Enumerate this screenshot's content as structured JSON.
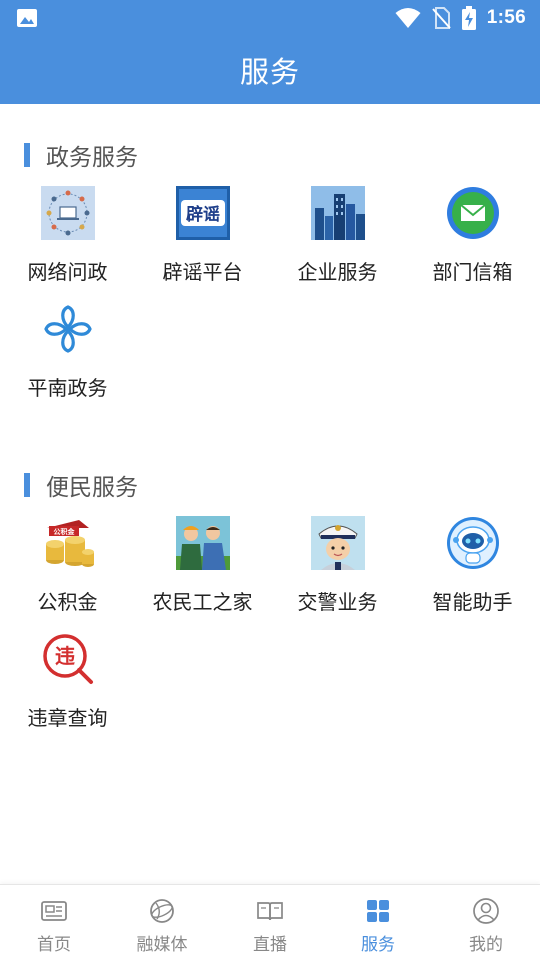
{
  "status_bar": {
    "time": "1:56",
    "icons": [
      "image-icon",
      "wifi-icon",
      "no-sim-icon",
      "battery-charging-icon"
    ]
  },
  "header": {
    "title": "服务"
  },
  "sections": [
    {
      "title": "政务服务",
      "items": [
        {
          "label": "网络问政",
          "icon": "network-people-icon"
        },
        {
          "label": "辟谣平台",
          "icon": "rumor-refute-icon"
        },
        {
          "label": "企业服务",
          "icon": "city-buildings-icon"
        },
        {
          "label": "部门信箱",
          "icon": "mail-envelope-icon"
        },
        {
          "label": "平南政务",
          "icon": "government-flower-icon"
        }
      ]
    },
    {
      "title": "便民服务",
      "items": [
        {
          "label": "公积金",
          "icon": "coins-stack-icon",
          "badge": "公积金"
        },
        {
          "label": "农民工之家",
          "icon": "workers-icon"
        },
        {
          "label": "交警业务",
          "icon": "traffic-police-icon"
        },
        {
          "label": "智能助手",
          "icon": "robot-assistant-icon"
        },
        {
          "label": "违章查询",
          "icon": "violation-search-icon",
          "badge": "违"
        }
      ]
    }
  ],
  "icon_text": {
    "rumor_badge": "辟谣"
  },
  "tab_bar": {
    "active_index": 3,
    "accent_color": "#4a8fdd",
    "tabs": [
      {
        "label": "首页",
        "icon": "news-icon"
      },
      {
        "label": "融媒体",
        "icon": "globe-icon"
      },
      {
        "label": "直播",
        "icon": "book-icon"
      },
      {
        "label": "服务",
        "icon": "grid-icon"
      },
      {
        "label": "我的",
        "icon": "user-icon"
      }
    ]
  },
  "colors": {
    "primary": "#4a8fdd",
    "background": "#ffffff"
  }
}
